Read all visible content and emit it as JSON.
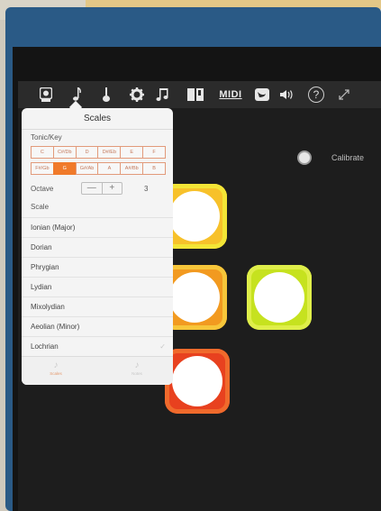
{
  "toolbar": {
    "icons": [
      "app-logo-icon",
      "music-note-icon",
      "guitar-icon",
      "gear-icon",
      "music-notes-icon",
      "piano-book-icon",
      "midi-icon",
      "swift-icon",
      "speaker-icon",
      "help-icon",
      "fullscreen-icon"
    ],
    "midi_label": "MIDI",
    "help_label": "?"
  },
  "calibrate": {
    "label": "Calibrate"
  },
  "popover": {
    "title": "Scales",
    "tonic_label": "Tonic/Key",
    "keys_row1": [
      "C",
      "C#/Db",
      "D",
      "D#/Eb",
      "E",
      "F"
    ],
    "keys_row2": [
      "F#/Gb",
      "G",
      "G#/Ab",
      "A",
      "A#/Bb",
      "B"
    ],
    "selected_key": "G",
    "octave_label": "Octave",
    "octave_minus": "—",
    "octave_plus": "+",
    "octave_value": "3",
    "scale_label": "Scale",
    "scales": [
      "Ionian (Major)",
      "Dorian",
      "Phrygian",
      "Lydian",
      "Mixolydian",
      "Aeolian (Minor)",
      "Lochrian"
    ],
    "selected_scale": "Lochrian",
    "check_mark": "✓",
    "footer": {
      "scales_label": "Scales",
      "notes_label": "Notes",
      "scales_icon": "♪",
      "notes_icon": "♪"
    }
  },
  "pads": [
    {
      "name": "pad-yellow",
      "color": "#f7c12a",
      "ring": "#f3e536"
    },
    {
      "name": "pad-orange",
      "color": "#f29a20",
      "ring": "#f7c63a"
    },
    {
      "name": "pad-lime",
      "color": "#c6e21f",
      "ring": "#dfee4a"
    },
    {
      "name": "pad-red",
      "color": "#e8411f",
      "ring": "#f06a2c"
    }
  ]
}
